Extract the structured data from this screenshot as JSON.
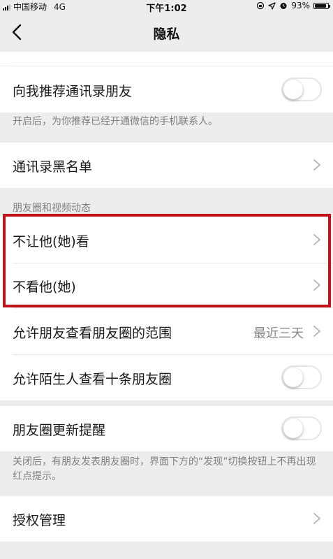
{
  "status_bar": {
    "carrier": "中国移动",
    "network": "4G",
    "time": "下午1:02",
    "battery_text": "93%",
    "battery_level": 0.93
  },
  "nav": {
    "title": "隐私",
    "back_icon": "chevron-left-icon"
  },
  "rows": {
    "recommend_contacts": {
      "label": "向我推荐通讯录朋友",
      "toggle_on": false
    },
    "recommend_note": "开启后，为你推荐已经开通微信的手机联系人。",
    "blacklist": {
      "label": "通讯录黑名单"
    },
    "moments_section_header": "朋友圈和视频动态",
    "hide_from": {
      "label": "不让他(她)看"
    },
    "dont_see": {
      "label": "不看他(她)"
    },
    "moments_range": {
      "label": "允许朋友查看朋友圈的范围",
      "value": "最近三天"
    },
    "stranger_view": {
      "label": "允许陌生人查看十条朋友圈",
      "toggle_on": false
    },
    "moments_update": {
      "label": "朋友圈更新提醒",
      "toggle_on": false
    },
    "moments_update_note": "关闭后，有朋友发表朋友圈时，界面下方的“发现”切换按钮上不再出现红点提示。",
    "authorization": {
      "label": "授权管理"
    }
  },
  "colors": {
    "background": "#EDEDED",
    "cell": "#FFFFFF",
    "highlight_border": "#C1121C",
    "secondary_text": "#7F7F7F"
  }
}
